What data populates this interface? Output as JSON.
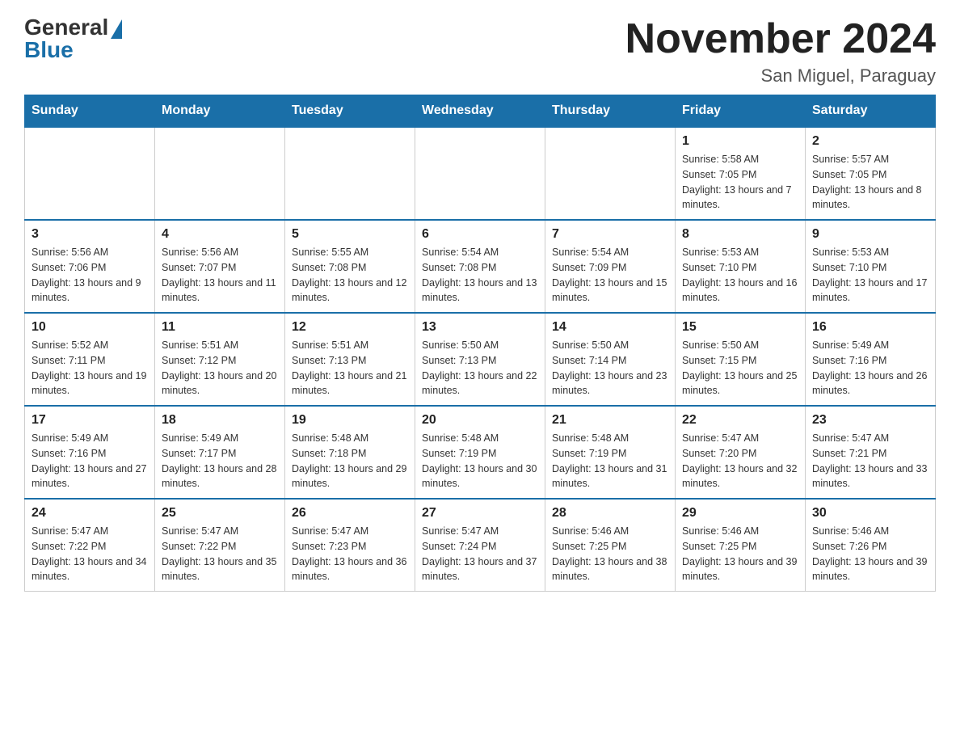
{
  "header": {
    "logo_general": "General",
    "logo_blue": "Blue",
    "month_title": "November 2024",
    "location": "San Miguel, Paraguay"
  },
  "weekdays": [
    "Sunday",
    "Monday",
    "Tuesday",
    "Wednesday",
    "Thursday",
    "Friday",
    "Saturday"
  ],
  "weeks": [
    [
      {
        "day": "",
        "sunrise": "",
        "sunset": "",
        "daylight": ""
      },
      {
        "day": "",
        "sunrise": "",
        "sunset": "",
        "daylight": ""
      },
      {
        "day": "",
        "sunrise": "",
        "sunset": "",
        "daylight": ""
      },
      {
        "day": "",
        "sunrise": "",
        "sunset": "",
        "daylight": ""
      },
      {
        "day": "",
        "sunrise": "",
        "sunset": "",
        "daylight": ""
      },
      {
        "day": "1",
        "sunrise": "Sunrise: 5:58 AM",
        "sunset": "Sunset: 7:05 PM",
        "daylight": "Daylight: 13 hours and 7 minutes."
      },
      {
        "day": "2",
        "sunrise": "Sunrise: 5:57 AM",
        "sunset": "Sunset: 7:05 PM",
        "daylight": "Daylight: 13 hours and 8 minutes."
      }
    ],
    [
      {
        "day": "3",
        "sunrise": "Sunrise: 5:56 AM",
        "sunset": "Sunset: 7:06 PM",
        "daylight": "Daylight: 13 hours and 9 minutes."
      },
      {
        "day": "4",
        "sunrise": "Sunrise: 5:56 AM",
        "sunset": "Sunset: 7:07 PM",
        "daylight": "Daylight: 13 hours and 11 minutes."
      },
      {
        "day": "5",
        "sunrise": "Sunrise: 5:55 AM",
        "sunset": "Sunset: 7:08 PM",
        "daylight": "Daylight: 13 hours and 12 minutes."
      },
      {
        "day": "6",
        "sunrise": "Sunrise: 5:54 AM",
        "sunset": "Sunset: 7:08 PM",
        "daylight": "Daylight: 13 hours and 13 minutes."
      },
      {
        "day": "7",
        "sunrise": "Sunrise: 5:54 AM",
        "sunset": "Sunset: 7:09 PM",
        "daylight": "Daylight: 13 hours and 15 minutes."
      },
      {
        "day": "8",
        "sunrise": "Sunrise: 5:53 AM",
        "sunset": "Sunset: 7:10 PM",
        "daylight": "Daylight: 13 hours and 16 minutes."
      },
      {
        "day": "9",
        "sunrise": "Sunrise: 5:53 AM",
        "sunset": "Sunset: 7:10 PM",
        "daylight": "Daylight: 13 hours and 17 minutes."
      }
    ],
    [
      {
        "day": "10",
        "sunrise": "Sunrise: 5:52 AM",
        "sunset": "Sunset: 7:11 PM",
        "daylight": "Daylight: 13 hours and 19 minutes."
      },
      {
        "day": "11",
        "sunrise": "Sunrise: 5:51 AM",
        "sunset": "Sunset: 7:12 PM",
        "daylight": "Daylight: 13 hours and 20 minutes."
      },
      {
        "day": "12",
        "sunrise": "Sunrise: 5:51 AM",
        "sunset": "Sunset: 7:13 PM",
        "daylight": "Daylight: 13 hours and 21 minutes."
      },
      {
        "day": "13",
        "sunrise": "Sunrise: 5:50 AM",
        "sunset": "Sunset: 7:13 PM",
        "daylight": "Daylight: 13 hours and 22 minutes."
      },
      {
        "day": "14",
        "sunrise": "Sunrise: 5:50 AM",
        "sunset": "Sunset: 7:14 PM",
        "daylight": "Daylight: 13 hours and 23 minutes."
      },
      {
        "day": "15",
        "sunrise": "Sunrise: 5:50 AM",
        "sunset": "Sunset: 7:15 PM",
        "daylight": "Daylight: 13 hours and 25 minutes."
      },
      {
        "day": "16",
        "sunrise": "Sunrise: 5:49 AM",
        "sunset": "Sunset: 7:16 PM",
        "daylight": "Daylight: 13 hours and 26 minutes."
      }
    ],
    [
      {
        "day": "17",
        "sunrise": "Sunrise: 5:49 AM",
        "sunset": "Sunset: 7:16 PM",
        "daylight": "Daylight: 13 hours and 27 minutes."
      },
      {
        "day": "18",
        "sunrise": "Sunrise: 5:49 AM",
        "sunset": "Sunset: 7:17 PM",
        "daylight": "Daylight: 13 hours and 28 minutes."
      },
      {
        "day": "19",
        "sunrise": "Sunrise: 5:48 AM",
        "sunset": "Sunset: 7:18 PM",
        "daylight": "Daylight: 13 hours and 29 minutes."
      },
      {
        "day": "20",
        "sunrise": "Sunrise: 5:48 AM",
        "sunset": "Sunset: 7:19 PM",
        "daylight": "Daylight: 13 hours and 30 minutes."
      },
      {
        "day": "21",
        "sunrise": "Sunrise: 5:48 AM",
        "sunset": "Sunset: 7:19 PM",
        "daylight": "Daylight: 13 hours and 31 minutes."
      },
      {
        "day": "22",
        "sunrise": "Sunrise: 5:47 AM",
        "sunset": "Sunset: 7:20 PM",
        "daylight": "Daylight: 13 hours and 32 minutes."
      },
      {
        "day": "23",
        "sunrise": "Sunrise: 5:47 AM",
        "sunset": "Sunset: 7:21 PM",
        "daylight": "Daylight: 13 hours and 33 minutes."
      }
    ],
    [
      {
        "day": "24",
        "sunrise": "Sunrise: 5:47 AM",
        "sunset": "Sunset: 7:22 PM",
        "daylight": "Daylight: 13 hours and 34 minutes."
      },
      {
        "day": "25",
        "sunrise": "Sunrise: 5:47 AM",
        "sunset": "Sunset: 7:22 PM",
        "daylight": "Daylight: 13 hours and 35 minutes."
      },
      {
        "day": "26",
        "sunrise": "Sunrise: 5:47 AM",
        "sunset": "Sunset: 7:23 PM",
        "daylight": "Daylight: 13 hours and 36 minutes."
      },
      {
        "day": "27",
        "sunrise": "Sunrise: 5:47 AM",
        "sunset": "Sunset: 7:24 PM",
        "daylight": "Daylight: 13 hours and 37 minutes."
      },
      {
        "day": "28",
        "sunrise": "Sunrise: 5:46 AM",
        "sunset": "Sunset: 7:25 PM",
        "daylight": "Daylight: 13 hours and 38 minutes."
      },
      {
        "day": "29",
        "sunrise": "Sunrise: 5:46 AM",
        "sunset": "Sunset: 7:25 PM",
        "daylight": "Daylight: 13 hours and 39 minutes."
      },
      {
        "day": "30",
        "sunrise": "Sunrise: 5:46 AM",
        "sunset": "Sunset: 7:26 PM",
        "daylight": "Daylight: 13 hours and 39 minutes."
      }
    ]
  ]
}
